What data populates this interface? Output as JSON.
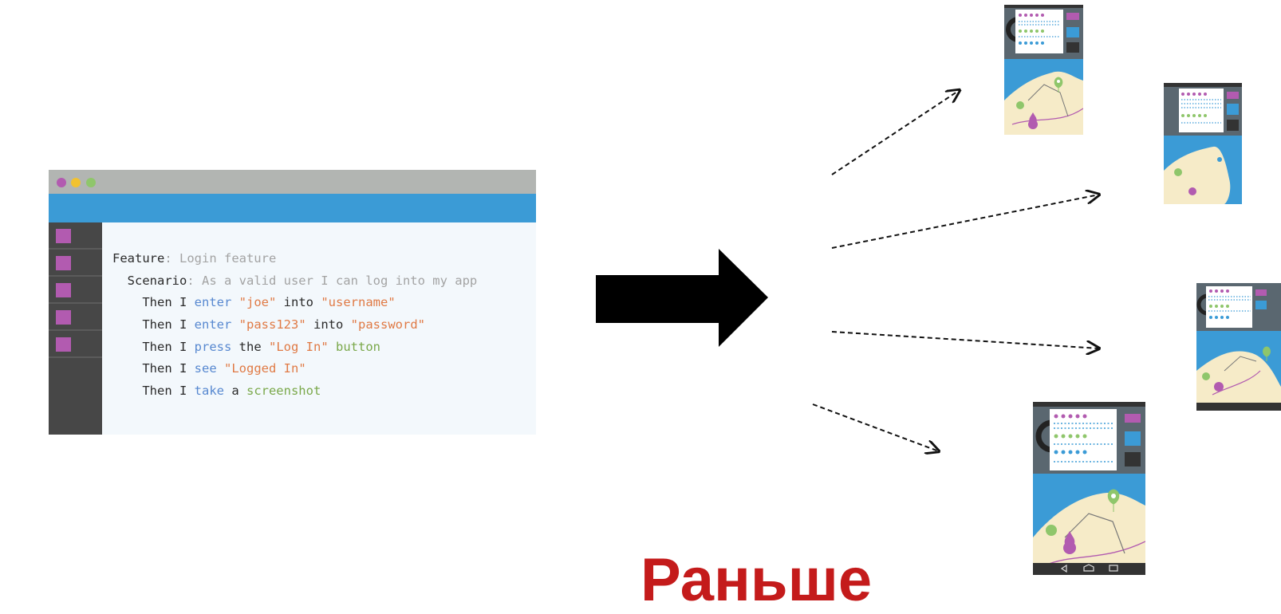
{
  "editor": {
    "window_dots": [
      "#b25bb0",
      "#f2c230",
      "#8fc66b"
    ],
    "sidebar_item_count": 5,
    "lines": [
      [
        {
          "t": "Feature",
          "c": "dark"
        },
        {
          "t": ": Login feature",
          "c": "gray"
        }
      ],
      [
        {
          "t": "  Scenario",
          "c": "dark"
        },
        {
          "t": ": As a valid user I can log into my app",
          "c": "gray"
        }
      ],
      [
        {
          "t": "    Then I ",
          "c": "dark"
        },
        {
          "t": "enter",
          "c": "blue"
        },
        {
          "t": " ",
          "c": "dark"
        },
        {
          "t": "\"joe\"",
          "c": "orange"
        },
        {
          "t": " into ",
          "c": "dark"
        },
        {
          "t": "\"username\"",
          "c": "orange"
        }
      ],
      [
        {
          "t": "    Then I ",
          "c": "dark"
        },
        {
          "t": "enter",
          "c": "blue"
        },
        {
          "t": " ",
          "c": "dark"
        },
        {
          "t": "\"pass123\"",
          "c": "orange"
        },
        {
          "t": " into ",
          "c": "dark"
        },
        {
          "t": "\"password\"",
          "c": "orange"
        }
      ],
      [
        {
          "t": "    Then I ",
          "c": "dark"
        },
        {
          "t": "press",
          "c": "blue"
        },
        {
          "t": " the ",
          "c": "dark"
        },
        {
          "t": "\"Log In\"",
          "c": "orange"
        },
        {
          "t": " ",
          "c": "dark"
        },
        {
          "t": "button",
          "c": "green"
        }
      ],
      [
        {
          "t": "    Then I ",
          "c": "dark"
        },
        {
          "t": "see",
          "c": "blue"
        },
        {
          "t": " ",
          "c": "dark"
        },
        {
          "t": "\"Logged In\"",
          "c": "orange"
        }
      ],
      [
        {
          "t": "    Then I ",
          "c": "dark"
        },
        {
          "t": "take",
          "c": "blue"
        },
        {
          "t": " a ",
          "c": "dark"
        },
        {
          "t": "screenshot",
          "c": "green"
        }
      ]
    ]
  },
  "caption": "Раньше",
  "colors": {
    "accent_blue": "#3b9bd6",
    "purple": "#b25bb0",
    "green": "#8fc66b",
    "sand": "#f6ebc8",
    "caption_red": "#c41b1b"
  },
  "devices": [
    {
      "name": "device-phone-top",
      "icon": "map-app-screenshot"
    },
    {
      "name": "device-tablet-right-top",
      "icon": "map-app-screenshot"
    },
    {
      "name": "device-phone-right-middle",
      "icon": "map-app-screenshot"
    },
    {
      "name": "device-phone-bottom",
      "icon": "map-app-screenshot"
    }
  ]
}
